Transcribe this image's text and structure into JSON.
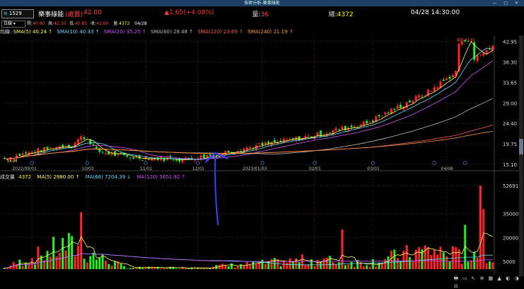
{
  "window": {
    "title": "技術分析-樂事綠能",
    "controls": [
      "—",
      "□",
      "✕"
    ]
  },
  "header": {
    "code": "1529",
    "name": "樂事綠能",
    "tag": "(處置)",
    "price": "42.00",
    "change": "▲1.65(+4.08%)",
    "volume_label": "量:",
    "volume": "36",
    "total_label": "總:",
    "total": "4372",
    "datetime": "04/28 14:30:00"
  },
  "ohlc": {
    "period": "日線",
    "items": [
      {
        "label": "開:",
        "value": "40.80"
      },
      {
        "label": "高:",
        "value": "42.30"
      },
      {
        "label": "低:",
        "value": "40.80"
      },
      {
        "label": "收:",
        "value": "42.00"
      },
      {
        "label": "量:",
        "value": "4372"
      },
      {
        "label": "",
        "value": "04/28"
      }
    ]
  },
  "ma_row": {
    "label": "均線:",
    "items": [
      {
        "text": "SMA(5) 40.24 ↑",
        "color": "#ffff66"
      },
      {
        "text": "SMA(10) 40.33 ↑",
        "color": "#66ddff"
      },
      {
        "text": "SMA(20) 35.25 ↑",
        "color": "#cc55ff"
      },
      {
        "text": "SMA(60) 28.48 ↑",
        "color": "#bbbbbb"
      },
      {
        "text": "SMA(120) 23.69 ↑",
        "color": "#ff5566"
      },
      {
        "text": "SMA(240) 21.19 ↑",
        "color": "#ff9933"
      }
    ]
  },
  "vol_row": {
    "label": "成交量",
    "value": "4372",
    "items": [
      {
        "text": "MA(5) 2980.00 ↑",
        "color": "#ffff66"
      },
      {
        "text": "MA(66) 7204.39 ↓",
        "color": "#66ddff"
      },
      {
        "text": "MA(120) 5651.92 ↑",
        "color": "#cc55ff"
      }
    ]
  },
  "price_axis": [
    "42.95",
    "38.30",
    "33.65",
    "29.00",
    "24.40",
    "19.75",
    "15.10"
  ],
  "volume_axis": [
    "52691",
    "35000",
    "20000",
    "5000"
  ],
  "date_axis": [
    "2022/09/01",
    "10/03",
    "11/01",
    "12/01",
    "2023/01/03",
    "02/01",
    "03/01",
    "04/06"
  ],
  "annotations": {
    "high_label": "最高 43.35",
    "low_label": "14.95"
  },
  "colors": {
    "up": "#ff2222",
    "down": "#22ee22",
    "grid": "#3a1a1a",
    "background": "#000000",
    "arrow": "#3344ff"
  },
  "chart_data": {
    "type": "line",
    "title": "",
    "xlabel": "",
    "ylabel": "",
    "x": [
      "2022/09/01",
      "10/03",
      "11/01",
      "12/01",
      "2023/01/03",
      "02/01",
      "03/01",
      "04/06",
      "04/28"
    ],
    "series": [
      {
        "name": "收",
        "values": [
          16.5,
          19.5,
          16.8,
          16.2,
          19.0,
          21.5,
          24.5,
          31.5,
          42.0
        ]
      }
    ],
    "volume": [
      800,
      15000,
      900,
      1000,
      3000,
      6000,
      4000,
      12000,
      4372
    ],
    "ylim": [
      15.1,
      44.0
    ],
    "volume_ylim": [
      0,
      55000
    ]
  },
  "toolbar": {
    "icons": [
      "🖶",
      "▭",
      "↖",
      "⊕",
      "▦",
      "▲",
      "◐",
      "◑",
      "⊟"
    ]
  }
}
